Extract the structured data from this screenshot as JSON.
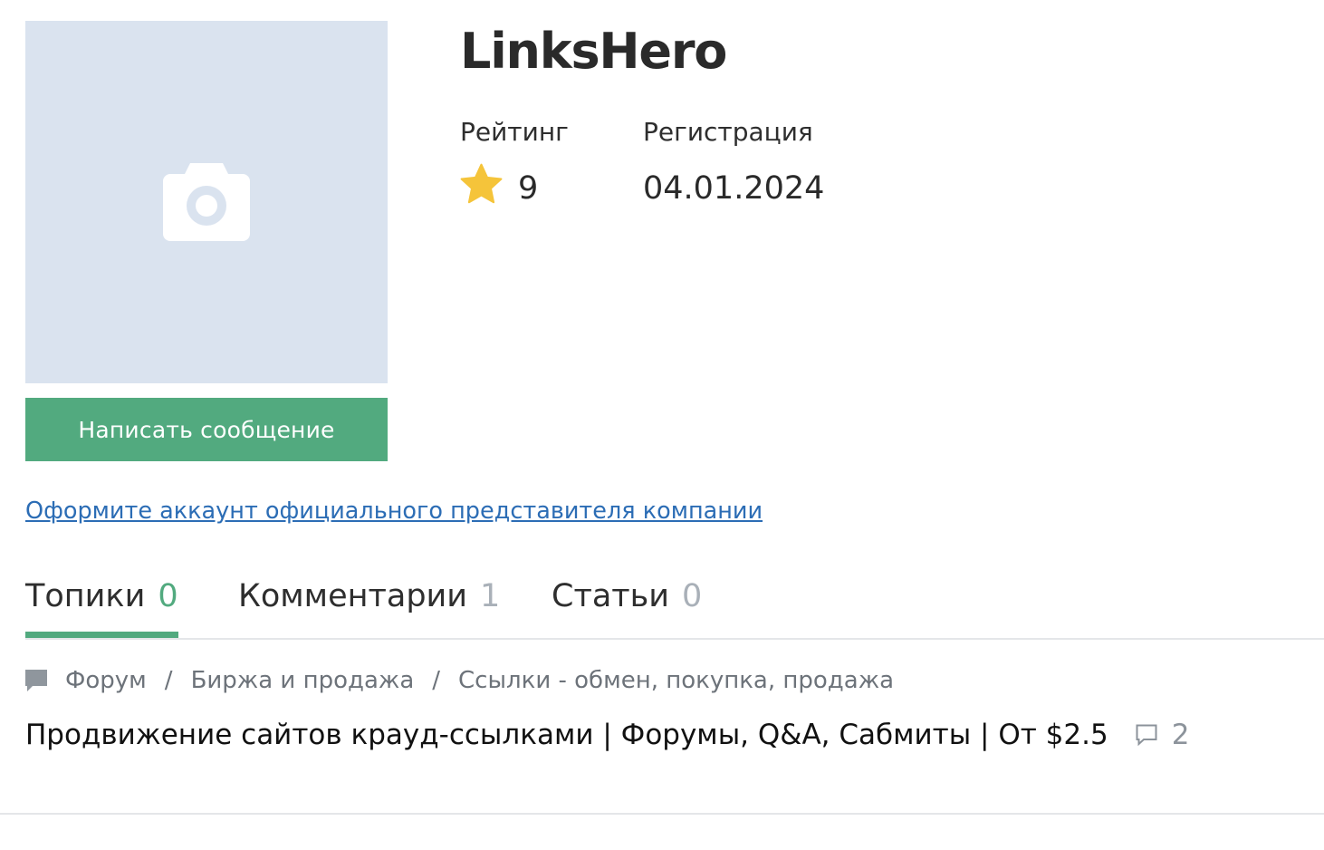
{
  "profile": {
    "username": "LinksHero",
    "avatar_icon": "camera-icon",
    "rating_label": "Рейтинг",
    "rating_value": "9",
    "registration_label": "Регистрация",
    "registration_value": "04.01.2024",
    "message_button_label": "Написать сообщение",
    "company_link_text": "Оформите аккаунт официального представителя компании"
  },
  "tabs": [
    {
      "label": "Топики",
      "count": "0",
      "active": true
    },
    {
      "label": "Комментарии",
      "count": "1",
      "active": false
    },
    {
      "label": "Статьи",
      "count": "0",
      "active": false
    }
  ],
  "breadcrumb": {
    "icon": "folder-icon",
    "items": [
      "Форум",
      "Биржа и продажа",
      "Ссылки - обмен, покупка, продажа"
    ],
    "separator": "/"
  },
  "topic": {
    "title": "Продвижение сайтов крауд-ссылками | Форумы, Q&A, Сабмиты | От $2.5",
    "comment_icon": "comment-icon",
    "comment_count": "2"
  },
  "colors": {
    "accent": "#52aa7f",
    "link": "#2c6db5",
    "avatar_bg": "#dae3ef",
    "star": "#f5c43a",
    "muted": "#a9b0b8"
  }
}
